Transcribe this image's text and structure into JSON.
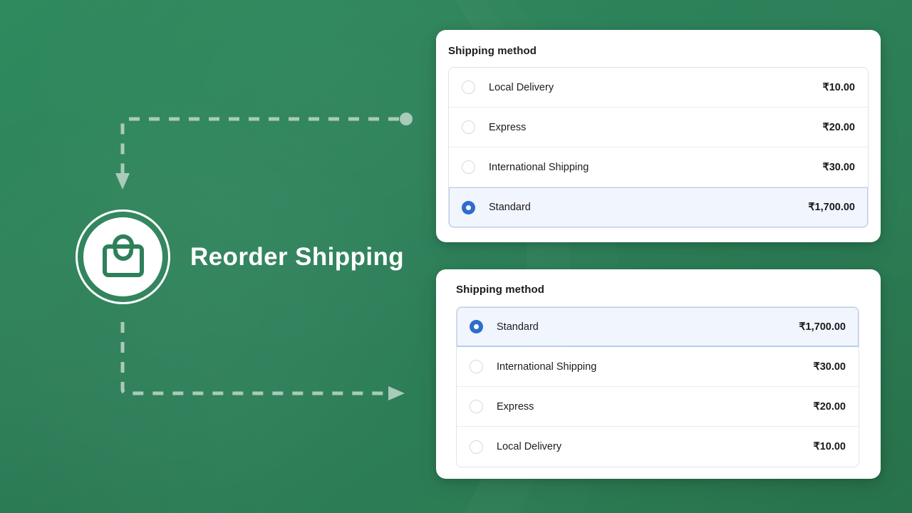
{
  "theme": {
    "background_green": "#2d8059",
    "accent_blue": "#2c6ecb",
    "selected_row_bg": "#f1f5fe",
    "selected_row_border": "#b7cdf0",
    "card_bg": "#ffffff",
    "text_color": "#1a1a1a",
    "divider": "#ededed",
    "dash_color": "#a9cbb9"
  },
  "hero": {
    "title": "Reorder Shipping",
    "logo_icon": "shopping-bag-icon"
  },
  "flow": {
    "top_arrow": {
      "start_marker": "circle-dot",
      "end_marker": "arrowhead-down",
      "direction": "right-to-left-then-down"
    },
    "bottom_arrow": {
      "start_marker": "none",
      "end_marker": "arrowhead-right",
      "direction": "down-then-left-to-right"
    }
  },
  "cards": [
    {
      "id": "before",
      "title": "Shipping method",
      "methods": [
        {
          "label": "Local Delivery",
          "price": "₹10.00",
          "selected": false
        },
        {
          "label": "Express",
          "price": "₹20.00",
          "selected": false
        },
        {
          "label": "International Shipping",
          "price": "₹30.00",
          "selected": false
        },
        {
          "label": "Standard",
          "price": "₹1,700.00",
          "selected": true
        }
      ]
    },
    {
      "id": "after",
      "title": "Shipping method",
      "methods": [
        {
          "label": "Standard",
          "price": "₹1,700.00",
          "selected": true
        },
        {
          "label": "International Shipping",
          "price": "₹30.00",
          "selected": false
        },
        {
          "label": "Express",
          "price": "₹20.00",
          "selected": false
        },
        {
          "label": "Local Delivery",
          "price": "₹10.00",
          "selected": false
        }
      ]
    }
  ]
}
